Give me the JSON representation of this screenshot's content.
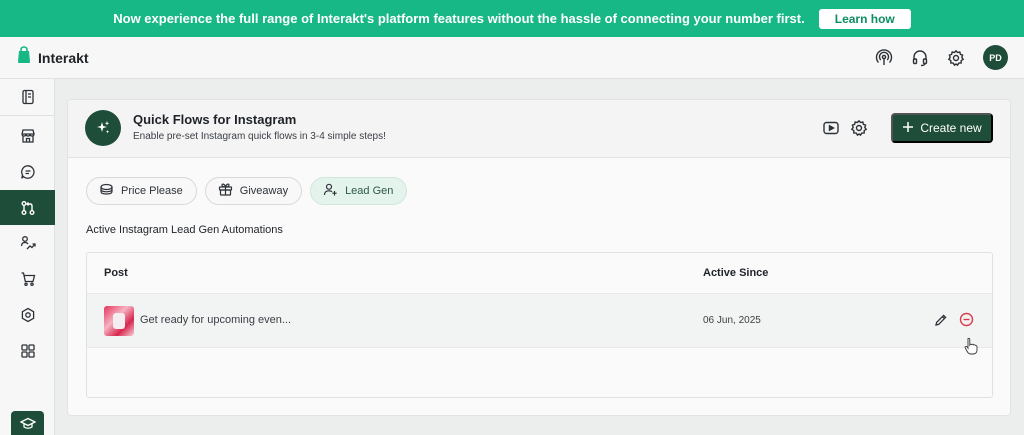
{
  "banner": {
    "text": "Now experience the full range of Interakt's platform features without the hassle of connecting your number first.",
    "button_label": "Learn how"
  },
  "topbar": {
    "brand_name": "Interakt",
    "icons": [
      "broadcast-icon",
      "headset-icon",
      "gear-icon"
    ],
    "avatar_initials": "PD"
  },
  "sidebar": {
    "items": [
      "notebook-icon",
      "store-icon",
      "chat-icon",
      "flows-icon",
      "campaign-icon",
      "cart-icon",
      "integrations-icon",
      "apps-icon",
      "academy-icon"
    ],
    "active_index": 3
  },
  "page": {
    "title": "Quick Flows for Instagram",
    "subtitle": "Enable pre-set Instagram quick flows in 3-4 simple steps!",
    "create_button": "Create new",
    "tabs": [
      {
        "label": "Price Please",
        "icon": "tag-icon"
      },
      {
        "label": "Giveaway",
        "icon": "gift-icon"
      },
      {
        "label": "Lead Gen",
        "icon": "user-add-icon"
      }
    ],
    "active_tab": "Lead Gen",
    "section_title": "Active Instagram Lead Gen Automations",
    "table": {
      "columns": [
        "Post",
        "Active Since"
      ],
      "rows": [
        {
          "post": "Get ready for upcoming even...",
          "active_since": "06 Jun, 2025"
        }
      ]
    }
  },
  "colors": {
    "banner": "#17b786",
    "primary_dark": "#1e4d3a",
    "active_tab_bg": "#e4f3ec",
    "delete_red": "#d93b4a"
  }
}
